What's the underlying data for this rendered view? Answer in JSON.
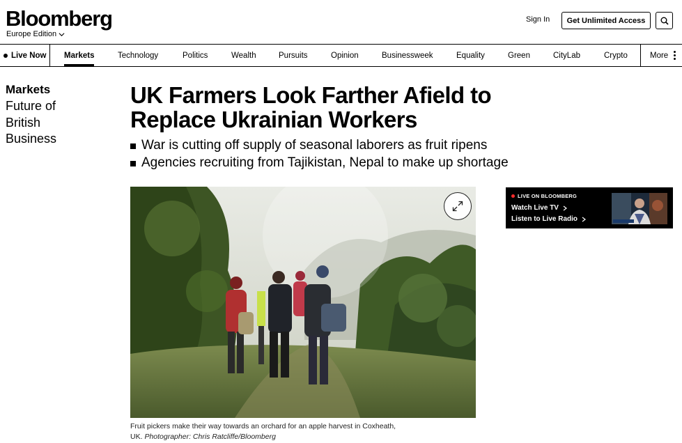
{
  "header": {
    "logo": "Bloomberg",
    "edition": "Europe Edition",
    "sign_in": "Sign In",
    "cta": "Get Unlimited Access"
  },
  "nav": {
    "live": "Live Now",
    "items": [
      "Markets",
      "Technology",
      "Politics",
      "Wealth",
      "Pursuits",
      "Opinion",
      "Businessweek",
      "Equality",
      "Green",
      "CityLab",
      "Crypto"
    ],
    "active": "Markets",
    "more": "More"
  },
  "section": {
    "title": "Markets",
    "subtitle_lines": [
      "Future of",
      "British",
      "Business"
    ]
  },
  "article": {
    "headline_lines": [
      "UK Farmers Look Farther Afield to",
      "Replace Ukrainian Workers"
    ],
    "bullets": [
      "War is cutting off supply of seasonal laborers as fruit ripens",
      "Agencies recruiting from Tajikistan, Nepal to make up shortage"
    ],
    "caption_line1": "Fruit pickers make their way towards an orchard for an apple harvest in Coxheath,",
    "caption_place": "UK.",
    "caption_credit": "Photographer: Chris Ratcliffe/Bloomberg"
  },
  "live_widget": {
    "tag": "LIVE ON BLOOMBERG",
    "tv_link": "Watch Live TV",
    "radio_link": "Listen to Live Radio"
  },
  "icons": {
    "edition": "chevron-down-icon",
    "search": "search-icon",
    "more": "vertical-dots-icon",
    "expand": "expand-icon",
    "link_arrow": "chevron-right-icon"
  },
  "colors": {
    "text": "#000000",
    "live_dot": "#ff2b2b",
    "widget_bg": "#000000"
  }
}
